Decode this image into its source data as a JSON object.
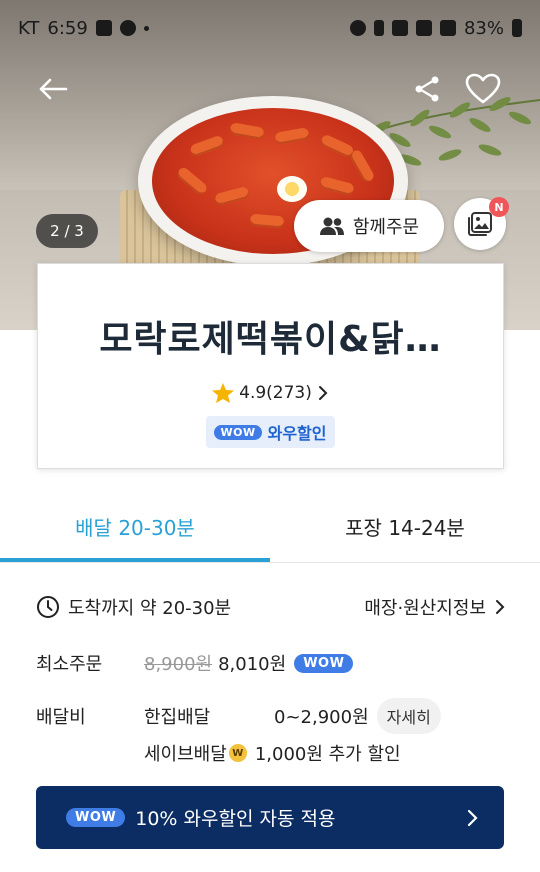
{
  "status_bar": {
    "carrier": "KT",
    "time": "6:59",
    "battery": "83%"
  },
  "hero": {
    "pager": "2 / 3",
    "group_order_label": "함께주문",
    "review_photo_badge": "N"
  },
  "store": {
    "name": "모락로제떡볶이&닭…",
    "rating": "4.9(273)",
    "wow_badge": "WOW",
    "wow_discount_label": "와우할인"
  },
  "tabs": [
    {
      "label": "배달 20-30분",
      "active": true
    },
    {
      "label": "포장 14-24분",
      "active": false
    }
  ],
  "details": {
    "arrival": "도착까지 약 20-30분",
    "store_info_link": "매장·원산지정보",
    "min_order_label": "최소주문",
    "min_order_original": "8,900원",
    "min_order_price": "8,010원",
    "min_order_badge": "WOW",
    "fee_label": "배달비",
    "fee_type": "한집배달",
    "fee_amount": "0~2,900원",
    "fee_detail_button": "자세히",
    "save_delivery_label": "세이브배달",
    "save_delivery_coin": "W",
    "save_delivery_text": "1,000원 추가 할인"
  },
  "banner": {
    "badge": "WOW",
    "text": "10% 와우할인 자동 적용"
  },
  "colors": {
    "accent": "#2aa1d6",
    "wow_blue": "#3f7ce6",
    "banner_navy": "#0c2d63",
    "badge_red": "#f0555a",
    "star": "#f5b400"
  }
}
